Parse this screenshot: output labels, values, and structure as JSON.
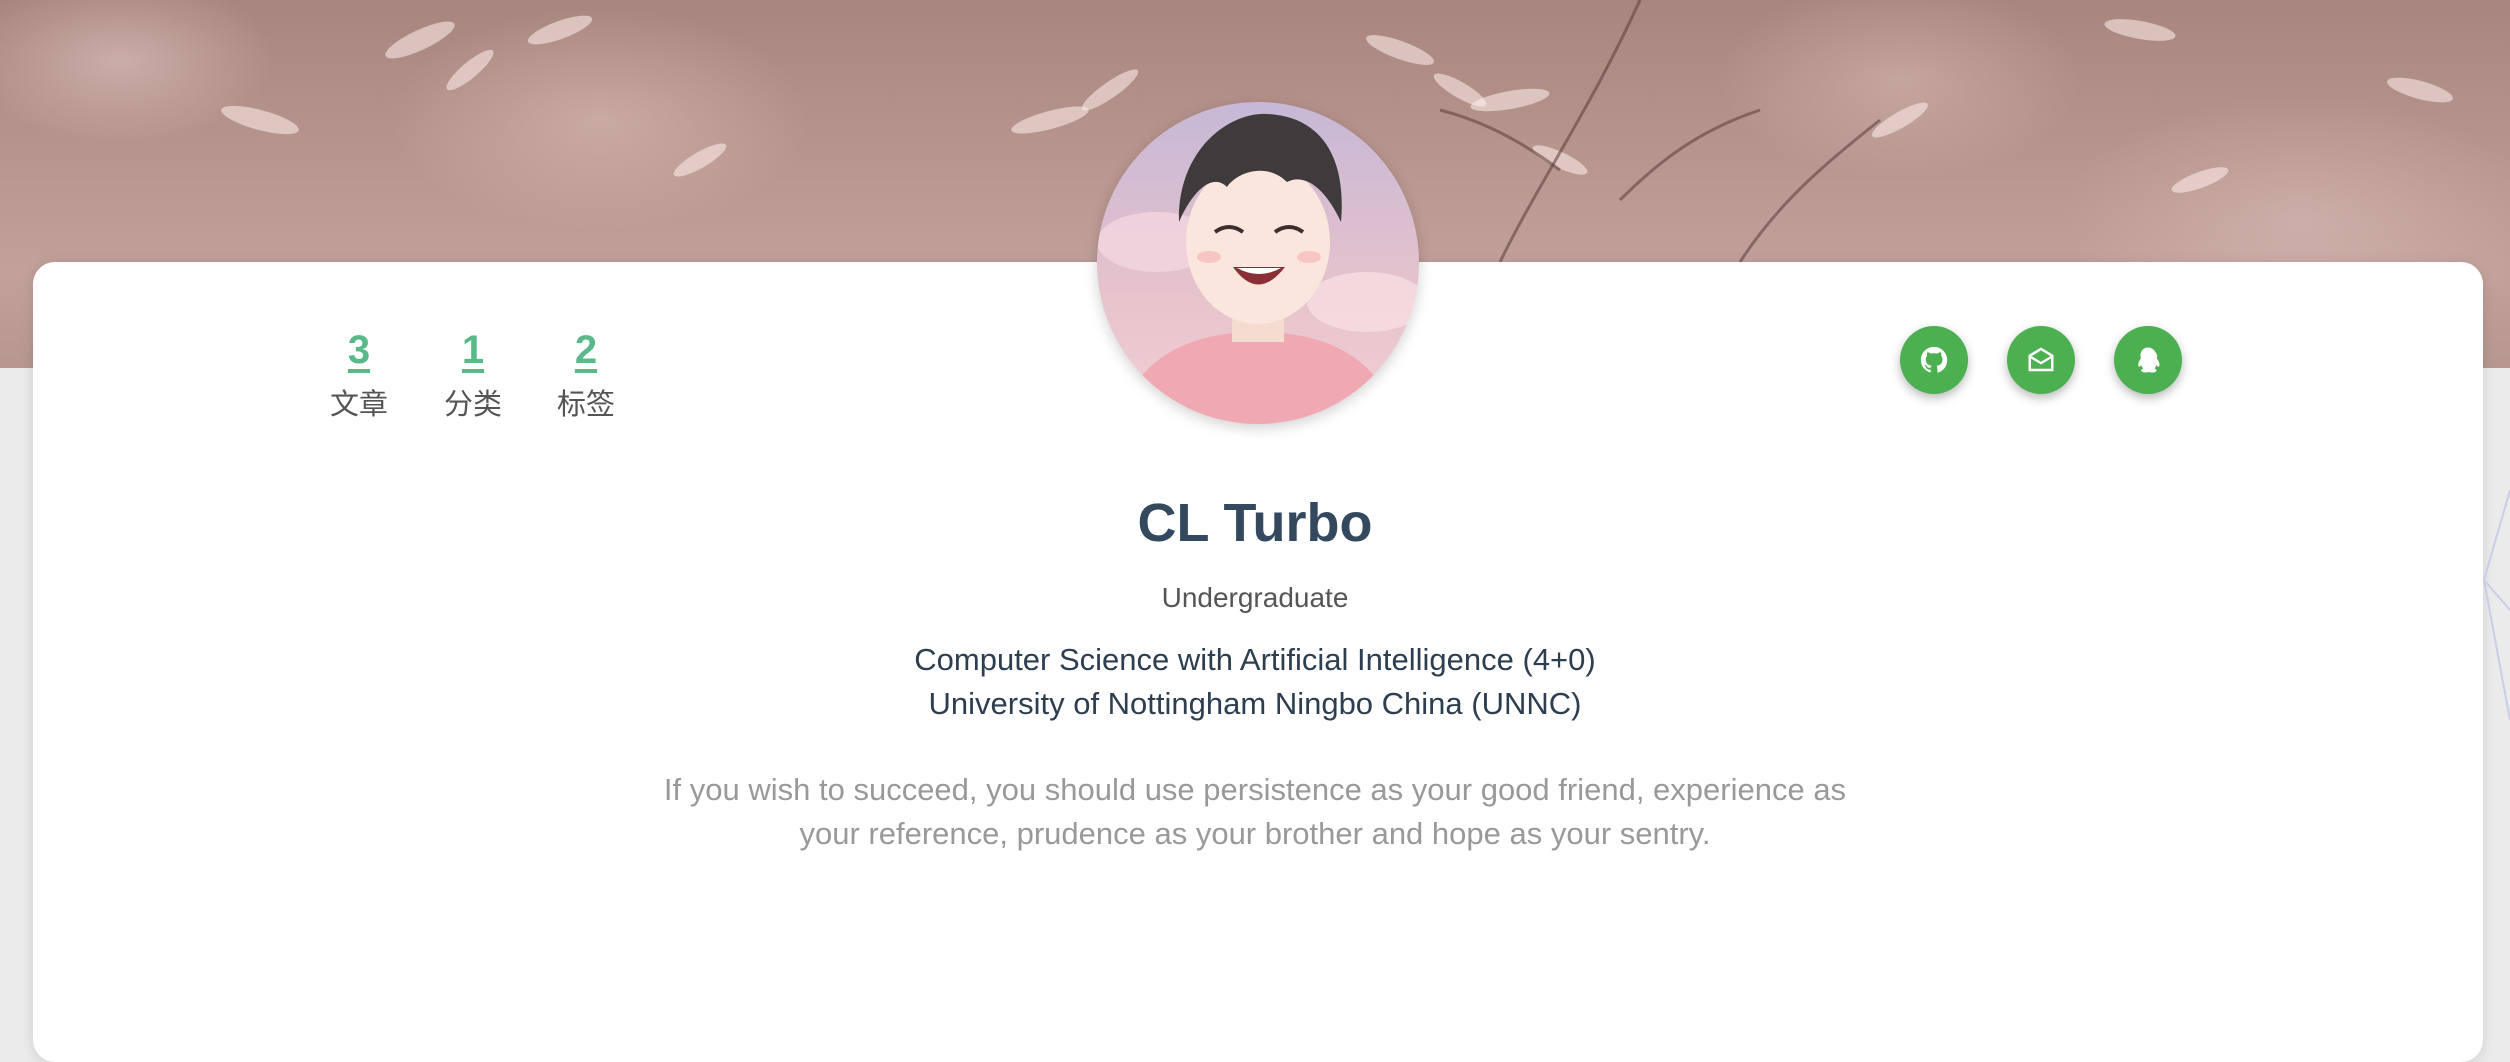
{
  "banner": {
    "description_icon": "dried-grass-photo"
  },
  "avatar": {
    "icon": "anime-boy-avatar"
  },
  "stats": [
    {
      "value": "3",
      "label": "文章"
    },
    {
      "value": "1",
      "label": "分类"
    },
    {
      "value": "2",
      "label": "标签"
    }
  ],
  "social": [
    {
      "icon": "github-icon"
    },
    {
      "icon": "email-icon"
    },
    {
      "icon": "qq-icon"
    }
  ],
  "profile": {
    "name": "CL Turbo",
    "role": "Undergraduate",
    "program_line1": "Computer Science with Artificial Intelligence (4+0)",
    "program_line2": "University of Nottingham Ningbo China (UNNC)",
    "quote_line1": "If you wish to succeed, you should use persistence as your good friend, experience as",
    "quote_line2": "your reference, prudence as your brother and hope as your sentry."
  },
  "colors": {
    "accent": "#5ab989",
    "button": "#4caf50",
    "name": "#34495e",
    "quote": "#999999"
  }
}
